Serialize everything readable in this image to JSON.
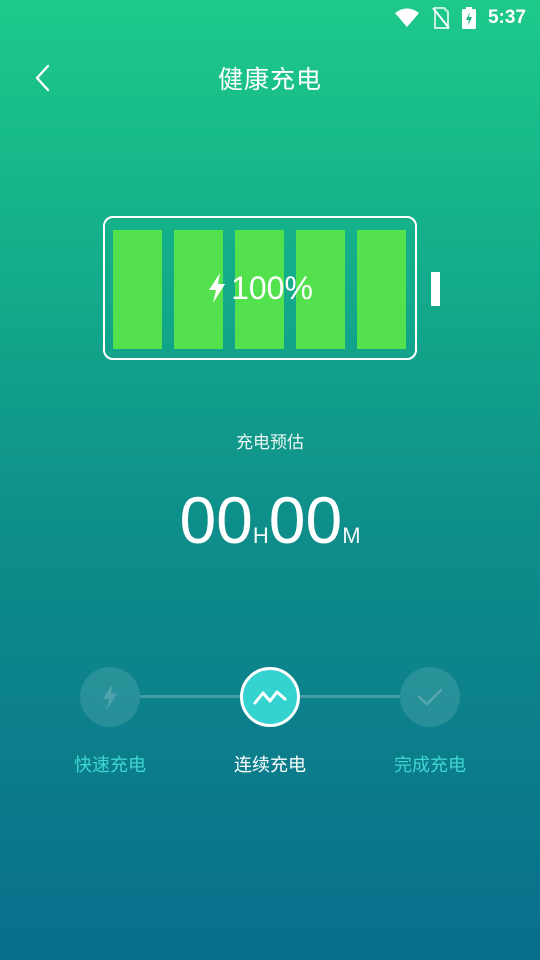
{
  "status_bar": {
    "time": "5:37",
    "icons": [
      "wifi-icon",
      "no-sim-icon",
      "battery-charging-icon"
    ]
  },
  "app_bar": {
    "title": "健康充电",
    "back_icon": "chevron-left-icon"
  },
  "battery": {
    "level_text": "100%",
    "level": 1.0,
    "cells": 5,
    "cell_color": "#53e24d",
    "icon": "lightning-icon"
  },
  "estimate": {
    "label": "充电预估",
    "hours": "00",
    "hours_unit": "H",
    "minutes": "00",
    "minutes_unit": "M"
  },
  "steps": [
    {
      "label": "快速充电",
      "icon": "lightning-icon",
      "state": "inactive"
    },
    {
      "label": "连续充电",
      "icon": "trend-icon",
      "state": "active"
    },
    {
      "label": "完成充电",
      "icon": "check-icon",
      "state": "inactive"
    }
  ],
  "colors": {
    "accent": "#35d3cf",
    "step_label_inactive": "#3fd6d0",
    "gradient_top": "#1ec98a",
    "gradient_bottom": "#086e8c"
  }
}
